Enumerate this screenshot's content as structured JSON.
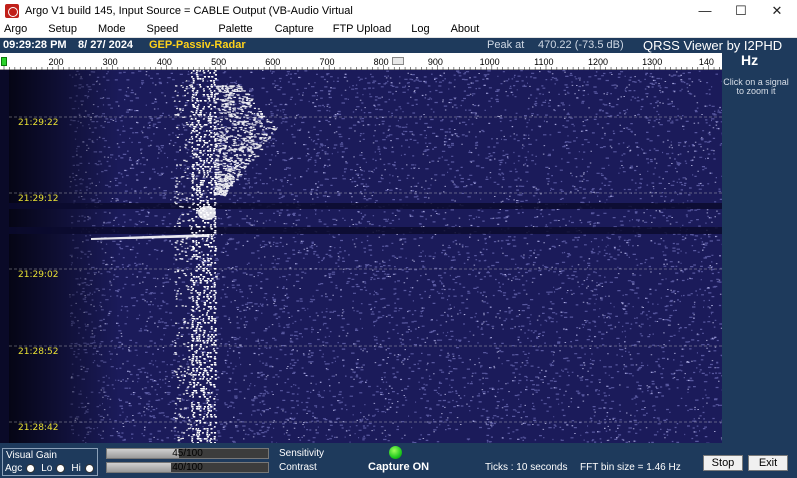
{
  "window": {
    "title": "Argo V1 build 145, Input Source = CABLE Output (VB-Audio Virtual",
    "minimize_icon": "minimize-icon",
    "maximize_icon": "maximize-icon",
    "close_icon": "close-icon"
  },
  "menu": [
    "Argo",
    "Setup",
    "Mode",
    "Speed",
    "Palette",
    "Capture",
    "FTP Upload",
    "Log",
    "About"
  ],
  "info": {
    "time": "09:29:28 PM",
    "date": "8/ 27/ 2024",
    "label": "GEP-Passiv-Radar",
    "peak_label": "Peak at",
    "peak_value": "470.22 (-73.5 dB)",
    "brand": "QRSS Viewer by I2PHD"
  },
  "ruler": {
    "ticks": [
      "200",
      "300",
      "400",
      "500",
      "600",
      "700",
      "800",
      "900",
      "1000",
      "1100",
      "1200",
      "1300",
      "140"
    ],
    "unit": "Hz"
  },
  "waterfall": {
    "timestamps": [
      "21:29:22",
      "21:29:12",
      "21:29:02",
      "21:28:52",
      "21:28:42"
    ],
    "background_color": "#1b1b5a",
    "signal_color": "#ffffff"
  },
  "right_panel": {
    "hint": "Click on a signal to zoom it"
  },
  "bottom": {
    "visual_gain_title": "Visual Gain",
    "gain_options": [
      {
        "label": "Agc",
        "selected": false
      },
      {
        "label": "Lo",
        "selected": false
      },
      {
        "label": "Hi",
        "selected": false
      }
    ],
    "sensitivity": {
      "text": "45/100",
      "value": 45,
      "max": 100,
      "label": "Sensitivity"
    },
    "contrast": {
      "text": "40/100",
      "value": 40,
      "max": 100,
      "label": "Contrast"
    },
    "capture_text": "Capture ON",
    "ticks_text": "Ticks   : 10 seconds",
    "fft_text": "FFT bin size = 1.46 Hz",
    "stop_label": "Stop",
    "exit_label": "Exit"
  },
  "colors": {
    "panel_bg": "#1e3a5c",
    "label_accent": "#ffd21a",
    "timestamp_color": "#e8e034",
    "capture_led": "#1ec81e"
  }
}
